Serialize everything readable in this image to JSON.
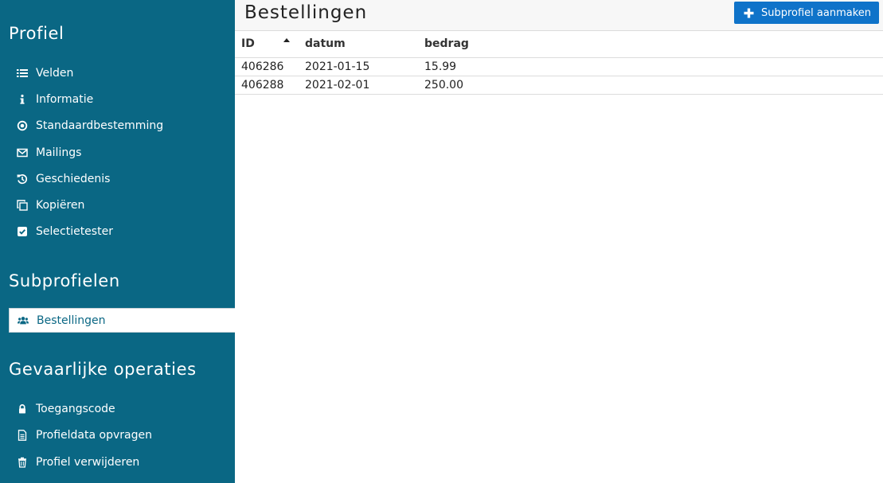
{
  "sidebar": {
    "section_profile": "Profiel",
    "profile_items": [
      {
        "label": "Velden",
        "icon": "list-icon"
      },
      {
        "label": "Informatie",
        "icon": "info-icon"
      },
      {
        "label": "Standaardbestemming",
        "icon": "dot-circle-icon"
      },
      {
        "label": "Mailings",
        "icon": "envelope-icon"
      },
      {
        "label": "Geschiedenis",
        "icon": "history-icon"
      },
      {
        "label": "Kopiëren",
        "icon": "copy-icon"
      },
      {
        "label": "Selectietester",
        "icon": "check-square-icon"
      }
    ],
    "section_subprofiles": "Subprofielen",
    "subprofile_items": [
      {
        "label": "Bestellingen",
        "icon": "users-icon",
        "active": true
      }
    ],
    "section_danger": "Gevaarlijke operaties",
    "danger_items": [
      {
        "label": "Toegangscode",
        "icon": "lock-icon"
      },
      {
        "label": "Profieldata opvragen",
        "icon": "file-text-icon"
      },
      {
        "label": "Profiel verwijderen",
        "icon": "trash-icon"
      }
    ]
  },
  "main": {
    "title": "Bestellingen",
    "create_button": "Subprofiel aanmaken",
    "table": {
      "columns": [
        "ID",
        "datum",
        "bedrag"
      ],
      "sorted_column": "ID",
      "sort_direction": "ascending",
      "rows": [
        [
          "406286",
          "2021-01-15",
          "15.99"
        ],
        [
          "406288",
          "2021-02-01",
          "250.00"
        ]
      ]
    }
  },
  "colors": {
    "sidebar_bg": "#0a6784",
    "button_bg": "#0f73c9",
    "topbar_bg": "#f7f7f7"
  }
}
